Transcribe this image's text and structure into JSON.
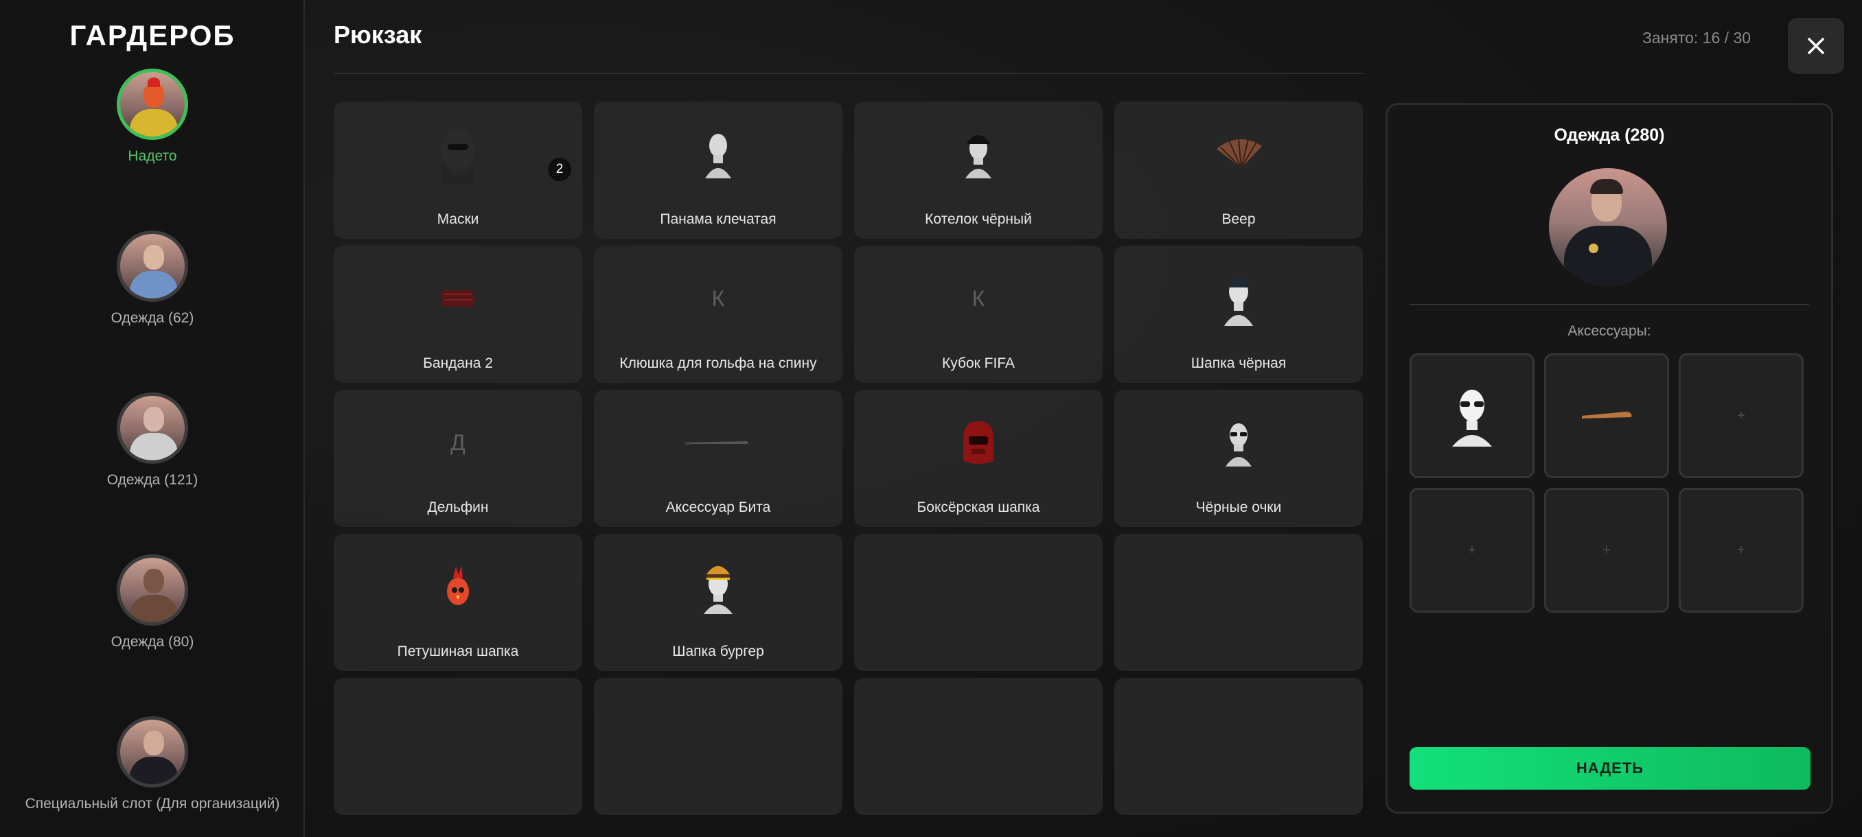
{
  "sidebar": {
    "title": "ГАРДЕРОБ",
    "slots": [
      {
        "label": "Надето",
        "active": true
      },
      {
        "label": "Одежда (62)",
        "active": false
      },
      {
        "label": "Одежда (121)",
        "active": false
      },
      {
        "label": "Одежда (80)",
        "active": false
      },
      {
        "label": "Специальный слот (Для организаций)",
        "active": false
      }
    ]
  },
  "header": {
    "title": "Рюкзак",
    "occupied": "Занято: 16 / 30"
  },
  "items": [
    {
      "name": "Маски",
      "icon": "balaclava-icon",
      "badge": "2"
    },
    {
      "name": "Панама клечатая",
      "icon": "mannequin-head-icon"
    },
    {
      "name": "Котелок чёрный",
      "icon": "bowler-hat-icon"
    },
    {
      "name": "Веер",
      "icon": "fan-icon"
    },
    {
      "name": "Бандана 2",
      "icon": "bandana-icon"
    },
    {
      "name": "Клюшка для гольфа на спину",
      "icon": "letter-placeholder-icon",
      "letter": "К"
    },
    {
      "name": "Кубок FIFA",
      "icon": "letter-placeholder-icon",
      "letter": "К"
    },
    {
      "name": "Шапка чёрная",
      "icon": "beanie-icon"
    },
    {
      "name": "Дельфин",
      "icon": "letter-placeholder-icon",
      "letter": "Д"
    },
    {
      "name": "Аксессуар Бита",
      "icon": "bat-icon"
    },
    {
      "name": "Боксёрская шапка",
      "icon": "boxing-helmet-icon"
    },
    {
      "name": "Чёрные очки",
      "icon": "sunglasses-head-icon"
    },
    {
      "name": "Петушиная шапка",
      "icon": "rooster-hat-icon"
    },
    {
      "name": "Шапка бургер",
      "icon": "burger-hat-icon"
    }
  ],
  "panel": {
    "title": "Одежда (280)",
    "accessories_label": "Аксессуары:",
    "accessories": [
      {
        "icon": "glasses-head-icon"
      },
      {
        "icon": "bat-icon"
      },
      {
        "icon": "empty-plus-icon",
        "placeholder": "+"
      },
      {
        "icon": "empty-plus-icon",
        "placeholder": "+"
      },
      {
        "icon": "empty-plus-icon",
        "placeholder": "+"
      },
      {
        "icon": "empty-plus-icon",
        "placeholder": "+"
      }
    ],
    "wear_button": "НАДЕТЬ"
  },
  "colors": {
    "accent_green": "#12e07a",
    "active_green": "#3fbf5a",
    "background": "#141414"
  }
}
